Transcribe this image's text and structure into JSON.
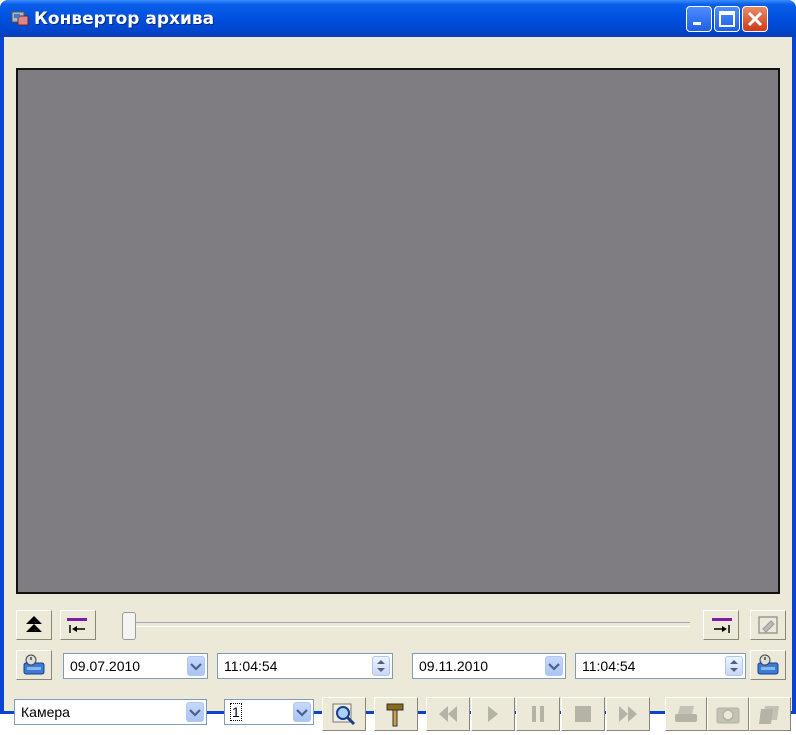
{
  "window": {
    "title": "Конвертор архива"
  },
  "timeline": {
    "start_date": "09.07.2010",
    "start_time": "11:04:54",
    "end_date": "09.11.2010",
    "end_time": "11:04:54"
  },
  "controls": {
    "camera_label": "Камера",
    "camera_number": "1"
  },
  "colors": {
    "titlebar": "#0052e0",
    "client_bg": "#ece9d8",
    "video_bg": "#7f7d82",
    "field_border": "#7f9db9"
  },
  "icons": [
    "app-icon",
    "minimize-icon",
    "maximize-icon",
    "close-icon",
    "collapse-up-icon",
    "mark-start-icon",
    "mark-end-icon",
    "export-icon",
    "calendar-start-icon",
    "calendar-end-icon",
    "search-icon",
    "settings-icon",
    "rewind-icon",
    "play-icon",
    "pause-icon",
    "stop-icon",
    "fast-forward-icon",
    "print-icon",
    "snapshot-icon",
    "copy-icon"
  ]
}
